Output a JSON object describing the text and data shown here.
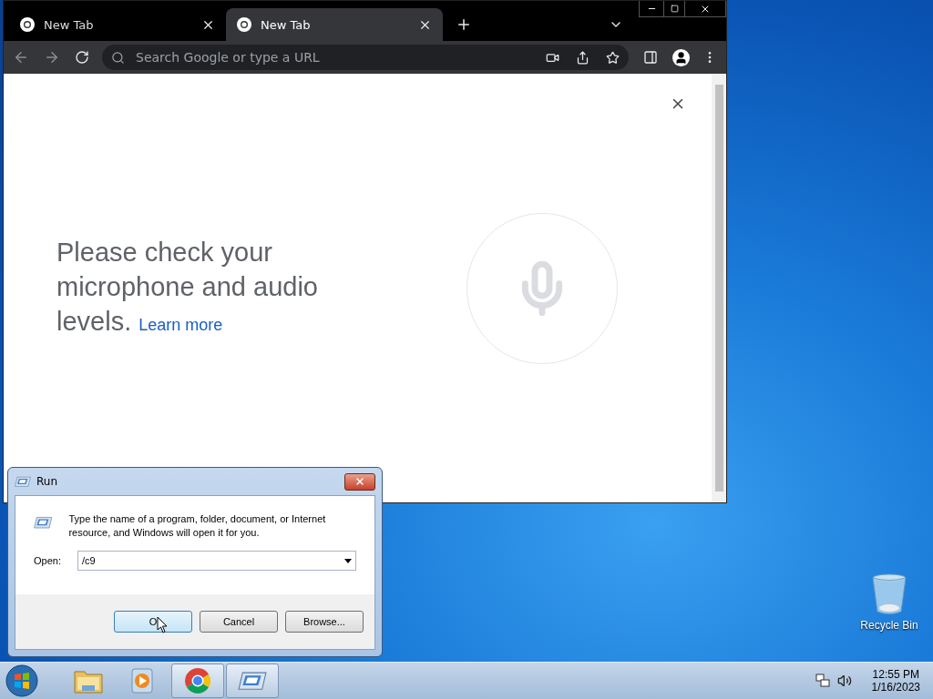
{
  "browser": {
    "tabs": [
      {
        "title": "New Tab",
        "selected": false
      },
      {
        "title": "New Tab",
        "selected": true
      }
    ],
    "address": {
      "placeholder": "Search Google or type a URL"
    },
    "page": {
      "message": "Please check your microphone and audio levels.",
      "link": "Learn more"
    }
  },
  "run_dialog": {
    "title": "Run",
    "description": "Type the name of a program, folder, document, or Internet resource, and Windows will open it for you.",
    "open_label": "Open:",
    "open_value": "/c9",
    "buttons": [
      {
        "label": "O",
        "default": true
      },
      {
        "label": "Cancel",
        "default": false
      },
      {
        "label": "Browse...",
        "default": false
      }
    ]
  },
  "desktop_icons": [
    {
      "label": "Recycle Bin"
    }
  ],
  "taskbar": {
    "apps": [
      {
        "kind": "explorer",
        "open": false
      },
      {
        "kind": "media",
        "open": false
      },
      {
        "kind": "chrome",
        "open": true
      },
      {
        "kind": "run",
        "open": true
      }
    ],
    "time": "12:55 PM",
    "date": "1/16/2023"
  }
}
